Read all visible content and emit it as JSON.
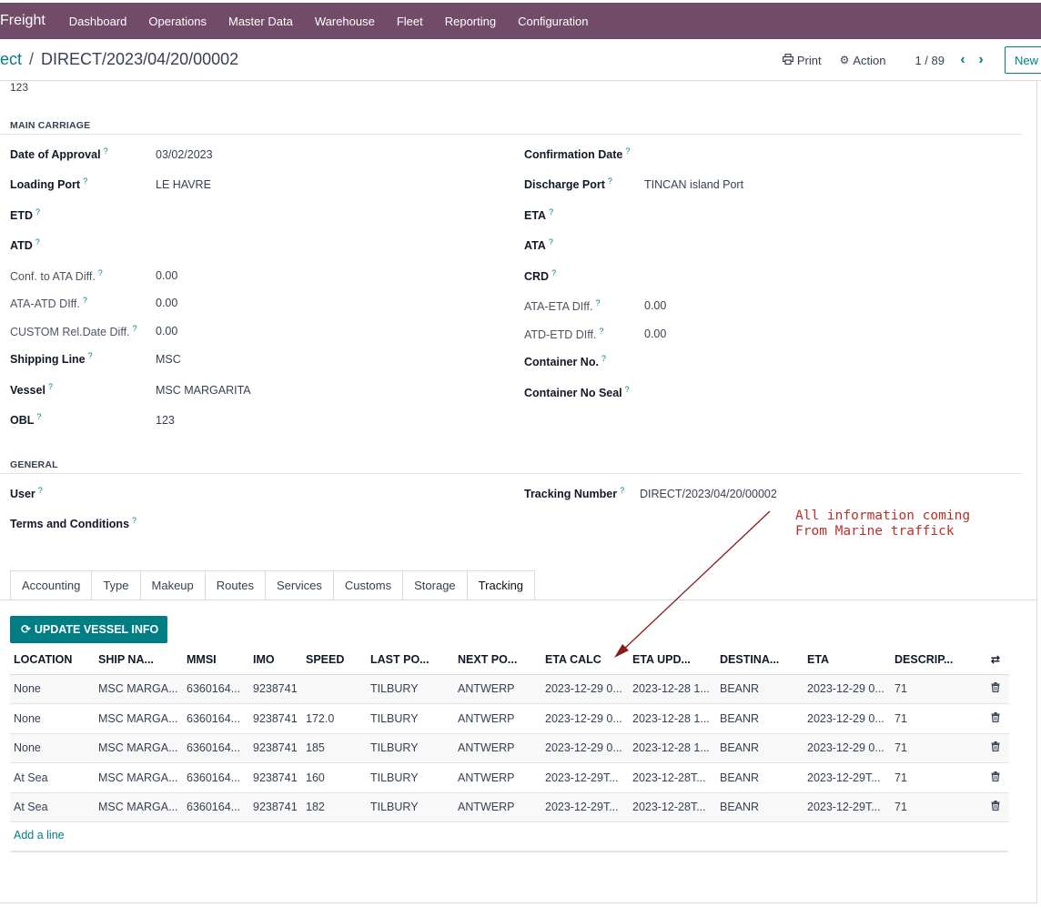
{
  "navbar": {
    "brand": "Freight",
    "menu": [
      "Dashboard",
      "Operations",
      "Master Data",
      "Warehouse",
      "Fleet",
      "Reporting",
      "Configuration"
    ]
  },
  "breadcrumb": {
    "parent": "ect",
    "separator": "/",
    "current": "DIRECT/2023/04/20/00002"
  },
  "toolbar": {
    "print": "Print",
    "action": "Action",
    "pager": "1 / 89",
    "new": "New"
  },
  "top_value": "123",
  "main_carriage": {
    "title": "MAIN CARRIAGE",
    "left": [
      {
        "label": "Date of Approval",
        "value": "03/02/2023",
        "light": false
      },
      {
        "label": "Loading Port",
        "value": "LE HAVRE",
        "light": false
      },
      {
        "label": "ETD",
        "value": "",
        "light": false
      },
      {
        "label": "ATD",
        "value": "",
        "light": false
      },
      {
        "label": "Conf. to ATA Diff.",
        "value": "0.00",
        "light": true
      },
      {
        "label": "ATA-ATD DIff.",
        "value": "0.00",
        "light": true
      },
      {
        "label": "CUSTOM Rel.Date Diff.",
        "value": "0.00",
        "light": true
      },
      {
        "label": "Shipping Line",
        "value": "MSC",
        "light": false
      },
      {
        "label": "Vessel",
        "value": "MSC MARGARITA",
        "light": false
      },
      {
        "label": "OBL",
        "value": "123",
        "light": false
      }
    ],
    "right": [
      {
        "label": "Confirmation Date",
        "value": "",
        "light": false
      },
      {
        "label": "Discharge Port",
        "value": "TINCAN island Port",
        "light": false
      },
      {
        "label": "ETA",
        "value": "",
        "light": false
      },
      {
        "label": "ATA",
        "value": "",
        "light": false
      },
      {
        "label": "CRD",
        "value": "",
        "light": false
      },
      {
        "label": "ATA-ETA DIff.",
        "value": "0.00",
        "light": true
      },
      {
        "label": "ATD-ETD DIff.",
        "value": "0.00",
        "light": true
      },
      {
        "label": "Container No.",
        "value": "",
        "light": false
      },
      {
        "label": "Container No Seal",
        "value": "",
        "light": false
      }
    ]
  },
  "general": {
    "title": "GENERAL",
    "user_label": "User",
    "terms_label": "Terms and Conditions",
    "tracking_label": "Tracking Number",
    "tracking_value": "DIRECT/2023/04/20/00002"
  },
  "annotation": "All information coming\nFrom Marine traffick",
  "tabs": [
    "Accounting",
    "Type",
    "Makeup",
    "Routes",
    "Services",
    "Customs",
    "Storage",
    "Tracking"
  ],
  "active_tab": "Tracking",
  "update_button": "UPDATE VESSEL INFO",
  "table": {
    "columns": [
      "LOCATION",
      "SHIP NA...",
      "MMSI",
      "IMO",
      "SPEED",
      "LAST PO...",
      "NEXT PO...",
      "ETA CALC",
      "ETA UPD...",
      "DESTINA...",
      "ETA",
      "DESCRIP..."
    ],
    "rows": [
      [
        "None",
        "MSC MARGA...",
        "6360164...",
        "9238741",
        "",
        "TILBURY",
        "ANTWERP",
        "2023-12-29 0...",
        "2023-12-28 1...",
        "BEANR",
        "2023-12-29 0...",
        "71"
      ],
      [
        "None",
        "MSC MARGA...",
        "6360164...",
        "9238741",
        "172.0",
        "TILBURY",
        "ANTWERP",
        "2023-12-29 0...",
        "2023-12-28 1...",
        "BEANR",
        "2023-12-29 0...",
        "71"
      ],
      [
        "None",
        "MSC MARGA...",
        "6360164...",
        "9238741",
        "185",
        "TILBURY",
        "ANTWERP",
        "2023-12-29 0...",
        "2023-12-28 1...",
        "BEANR",
        "2023-12-29 0...",
        "71"
      ],
      [
        "At Sea",
        "MSC MARGA...",
        "6360164...",
        "9238741",
        "160",
        "TILBURY",
        "ANTWERP",
        "2023-12-29T...",
        "2023-12-28T...",
        "BEANR",
        "2023-12-29T...",
        "71"
      ],
      [
        "At Sea",
        "MSC MARGA...",
        "6360164...",
        "9238741",
        "182",
        "TILBURY",
        "ANTWERP",
        "2023-12-29T...",
        "2023-12-28T...",
        "BEANR",
        "2023-12-29T...",
        "71"
      ]
    ],
    "add_line": "Add a line"
  }
}
